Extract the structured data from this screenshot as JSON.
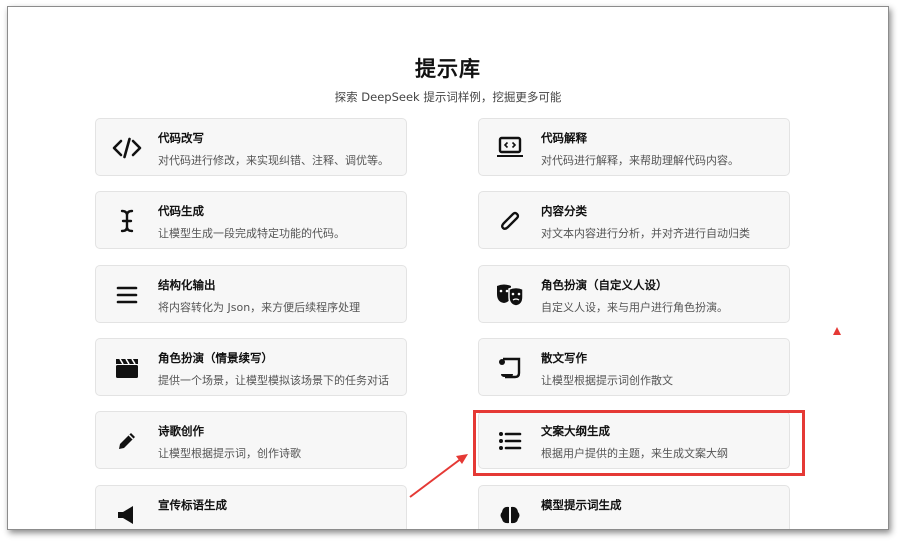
{
  "header": {
    "title": "提示库",
    "subtitle": "探索 DeepSeek 提示词样例，挖掘更多可能"
  },
  "cards": [
    {
      "name": "代码改写",
      "desc": "对代码进行修改，来实现纠错、注释、调优等。",
      "icon": "code-icon"
    },
    {
      "name": "代码解释",
      "desc": "对代码进行解释，来帮助理解代码内容。",
      "icon": "laptop-code-icon"
    },
    {
      "name": "代码生成",
      "desc": "让模型生成一段完成特定功能的代码。",
      "icon": "text-cursor-icon"
    },
    {
      "name": "内容分类",
      "desc": "对文本内容进行分析，并对齐进行自动归类",
      "icon": "paperclip-icon"
    },
    {
      "name": "结构化输出",
      "desc": "将内容转化为 Json，来方便后续程序处理",
      "icon": "menu-icon"
    },
    {
      "name": "角色扮演（自定义人设）",
      "desc": "自定义人设，来与用户进行角色扮演。",
      "icon": "masks-icon"
    },
    {
      "name": "角色扮演（情景续写）",
      "desc": "提供一个场景，让模型模拟该场景下的任务对话",
      "icon": "clapperboard-icon"
    },
    {
      "name": "散文写作",
      "desc": "让模型根据提示词创作散文",
      "icon": "scroll-icon"
    },
    {
      "name": "诗歌创作",
      "desc": "让模型根据提示词，创作诗歌",
      "icon": "pencil-icon"
    },
    {
      "name": "文案大纲生成",
      "desc": "根据用户提供的主题，来生成文案大纲",
      "icon": "list-icon"
    },
    {
      "name": "宣传标语生成",
      "desc": "",
      "icon": "megaphone-icon"
    },
    {
      "name": "模型提示词生成",
      "desc": "",
      "icon": "brain-icon"
    }
  ],
  "colors": {
    "highlight": "#e53935",
    "card_bg": "#f7f7f7"
  }
}
